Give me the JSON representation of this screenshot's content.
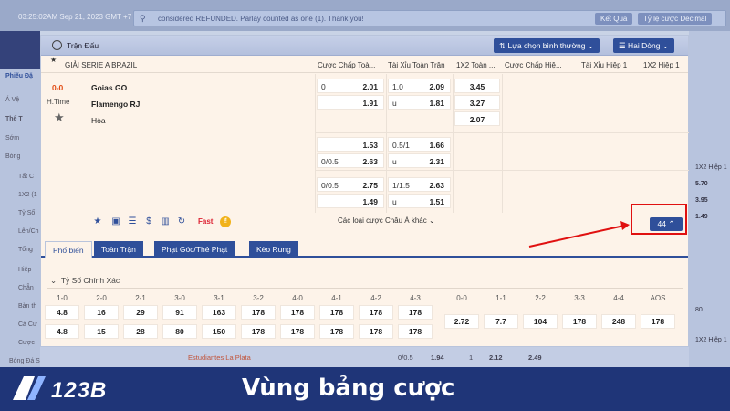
{
  "background": {
    "clock": "03:25:02AM Sep 21, 2023 GMT +7",
    "notice": "considered REFUNDED. Parlay counted as one (1). Thank you!",
    "btn_result": "Kết Quả",
    "btn_odds": "Tỷ lệ cược Decimal",
    "left_items": [
      "Phiếu Đặ",
      "Á Vệ",
      "Thể T",
      "Sớm",
      "Bóng",
      "Tất C",
      "1X2 (1",
      "Tỷ Số",
      "Lên/Ch",
      "Tổng",
      "Hiệp",
      "Chẵn",
      "Bàn th",
      "Cá Cư",
      "Cược",
      "Bóng Đá Saba"
    ],
    "right_items": [
      "1X2 Hiệp 1",
      "5.70",
      "3.95",
      "1.49",
      "80",
      "1X2 Hiệp 1"
    ],
    "bottom_row": [
      "Estudiantes La Plata",
      "0/0.5",
      "1.94",
      "1",
      "2.12",
      "2.49"
    ]
  },
  "modal": {
    "title": "Trận Đấu",
    "sort_button": "Lựa chọn bình thường",
    "view_button": "Hai Dòng",
    "league": "GIẢI SERIE A BRAZIL",
    "column_headers": [
      "Cược Chấp Toà...",
      "Tài Xỉu Toàn Trận",
      "1X2 Toàn ...",
      "Cược Chấp Hiệ...",
      "Tài Xỉu Hiệp 1",
      "1X2 Hiệp 1"
    ],
    "score": "0-0",
    "time": "H.Time",
    "home": "Goias GO",
    "away": "Flamengo RJ",
    "draw": "Hòa",
    "handicap_rows": [
      {
        "line": "0",
        "odds1": "2.01",
        "odds2": "1.91"
      },
      {
        "line": "0/0.5",
        "odds1": "1.53",
        "odds2": "2.63"
      },
      {
        "line": "0/0.5",
        "odds1": "2.75",
        "odds2": "1.49"
      }
    ],
    "ou_rows": [
      {
        "line": "1.0",
        "odds1": "2.09",
        "u": "u",
        "odds2": "1.81"
      },
      {
        "line": "0.5/1",
        "odds1": "1.66",
        "u": "u",
        "odds2": "2.31"
      },
      {
        "line": "1/1.5",
        "odds1": "2.63",
        "u": "u",
        "odds2": "1.51"
      }
    ],
    "x12": [
      "3.45",
      "3.27",
      "2.07"
    ],
    "icon_fast": "Fast",
    "other_bets_link": "Các loại cược Châu Á khác",
    "more_count": "44",
    "tabs": [
      "Phổ biến",
      "Toàn Trận",
      "Phạt Góc/Thẻ Phạt",
      "Kèo Rung"
    ],
    "section_title": "Tỷ Số Chính Xác",
    "cs_headers": [
      "1-0",
      "2-0",
      "2-1",
      "3-0",
      "3-1",
      "3-2",
      "4-0",
      "4-1",
      "4-2",
      "4-3",
      "0-0",
      "1-1",
      "2-2",
      "3-3",
      "4-4",
      "AOS"
    ],
    "cs_home": [
      "4.8",
      "16",
      "29",
      "91",
      "163",
      "178",
      "178",
      "178",
      "178",
      "178"
    ],
    "cs_away": [
      "4.8",
      "15",
      "28",
      "80",
      "150",
      "178",
      "178",
      "178",
      "178",
      "178"
    ],
    "cs_draw": [
      "2.72",
      "7.7",
      "104",
      "178",
      "248",
      "178"
    ]
  },
  "footer": {
    "logo": "123B",
    "title": "Vùng bảng cược"
  },
  "colors": {
    "primary": "#2f4f9a",
    "highlight": "#e01010",
    "footer": "#1f3578",
    "score": "#e24b12"
  }
}
